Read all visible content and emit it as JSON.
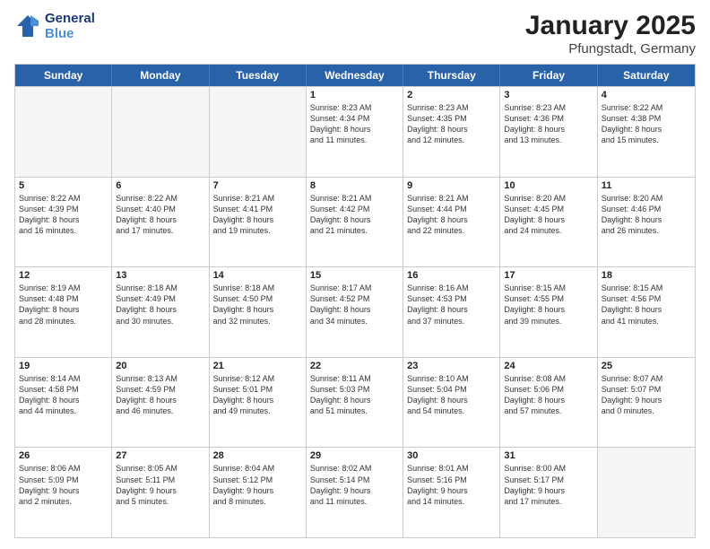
{
  "logo": {
    "line1": "General",
    "line2": "Blue"
  },
  "title": "January 2025",
  "location": "Pfungstadt, Germany",
  "header_days": [
    "Sunday",
    "Monday",
    "Tuesday",
    "Wednesday",
    "Thursday",
    "Friday",
    "Saturday"
  ],
  "weeks": [
    [
      {
        "day": "",
        "lines": []
      },
      {
        "day": "",
        "lines": []
      },
      {
        "day": "",
        "lines": []
      },
      {
        "day": "1",
        "lines": [
          "Sunrise: 8:23 AM",
          "Sunset: 4:34 PM",
          "Daylight: 8 hours",
          "and 11 minutes."
        ]
      },
      {
        "day": "2",
        "lines": [
          "Sunrise: 8:23 AM",
          "Sunset: 4:35 PM",
          "Daylight: 8 hours",
          "and 12 minutes."
        ]
      },
      {
        "day": "3",
        "lines": [
          "Sunrise: 8:23 AM",
          "Sunset: 4:36 PM",
          "Daylight: 8 hours",
          "and 13 minutes."
        ]
      },
      {
        "day": "4",
        "lines": [
          "Sunrise: 8:22 AM",
          "Sunset: 4:38 PM",
          "Daylight: 8 hours",
          "and 15 minutes."
        ]
      }
    ],
    [
      {
        "day": "5",
        "lines": [
          "Sunrise: 8:22 AM",
          "Sunset: 4:39 PM",
          "Daylight: 8 hours",
          "and 16 minutes."
        ]
      },
      {
        "day": "6",
        "lines": [
          "Sunrise: 8:22 AM",
          "Sunset: 4:40 PM",
          "Daylight: 8 hours",
          "and 17 minutes."
        ]
      },
      {
        "day": "7",
        "lines": [
          "Sunrise: 8:21 AM",
          "Sunset: 4:41 PM",
          "Daylight: 8 hours",
          "and 19 minutes."
        ]
      },
      {
        "day": "8",
        "lines": [
          "Sunrise: 8:21 AM",
          "Sunset: 4:42 PM",
          "Daylight: 8 hours",
          "and 21 minutes."
        ]
      },
      {
        "day": "9",
        "lines": [
          "Sunrise: 8:21 AM",
          "Sunset: 4:44 PM",
          "Daylight: 8 hours",
          "and 22 minutes."
        ]
      },
      {
        "day": "10",
        "lines": [
          "Sunrise: 8:20 AM",
          "Sunset: 4:45 PM",
          "Daylight: 8 hours",
          "and 24 minutes."
        ]
      },
      {
        "day": "11",
        "lines": [
          "Sunrise: 8:20 AM",
          "Sunset: 4:46 PM",
          "Daylight: 8 hours",
          "and 26 minutes."
        ]
      }
    ],
    [
      {
        "day": "12",
        "lines": [
          "Sunrise: 8:19 AM",
          "Sunset: 4:48 PM",
          "Daylight: 8 hours",
          "and 28 minutes."
        ]
      },
      {
        "day": "13",
        "lines": [
          "Sunrise: 8:18 AM",
          "Sunset: 4:49 PM",
          "Daylight: 8 hours",
          "and 30 minutes."
        ]
      },
      {
        "day": "14",
        "lines": [
          "Sunrise: 8:18 AM",
          "Sunset: 4:50 PM",
          "Daylight: 8 hours",
          "and 32 minutes."
        ]
      },
      {
        "day": "15",
        "lines": [
          "Sunrise: 8:17 AM",
          "Sunset: 4:52 PM",
          "Daylight: 8 hours",
          "and 34 minutes."
        ]
      },
      {
        "day": "16",
        "lines": [
          "Sunrise: 8:16 AM",
          "Sunset: 4:53 PM",
          "Daylight: 8 hours",
          "and 37 minutes."
        ]
      },
      {
        "day": "17",
        "lines": [
          "Sunrise: 8:15 AM",
          "Sunset: 4:55 PM",
          "Daylight: 8 hours",
          "and 39 minutes."
        ]
      },
      {
        "day": "18",
        "lines": [
          "Sunrise: 8:15 AM",
          "Sunset: 4:56 PM",
          "Daylight: 8 hours",
          "and 41 minutes."
        ]
      }
    ],
    [
      {
        "day": "19",
        "lines": [
          "Sunrise: 8:14 AM",
          "Sunset: 4:58 PM",
          "Daylight: 8 hours",
          "and 44 minutes."
        ]
      },
      {
        "day": "20",
        "lines": [
          "Sunrise: 8:13 AM",
          "Sunset: 4:59 PM",
          "Daylight: 8 hours",
          "and 46 minutes."
        ]
      },
      {
        "day": "21",
        "lines": [
          "Sunrise: 8:12 AM",
          "Sunset: 5:01 PM",
          "Daylight: 8 hours",
          "and 49 minutes."
        ]
      },
      {
        "day": "22",
        "lines": [
          "Sunrise: 8:11 AM",
          "Sunset: 5:03 PM",
          "Daylight: 8 hours",
          "and 51 minutes."
        ]
      },
      {
        "day": "23",
        "lines": [
          "Sunrise: 8:10 AM",
          "Sunset: 5:04 PM",
          "Daylight: 8 hours",
          "and 54 minutes."
        ]
      },
      {
        "day": "24",
        "lines": [
          "Sunrise: 8:08 AM",
          "Sunset: 5:06 PM",
          "Daylight: 8 hours",
          "and 57 minutes."
        ]
      },
      {
        "day": "25",
        "lines": [
          "Sunrise: 8:07 AM",
          "Sunset: 5:07 PM",
          "Daylight: 9 hours",
          "and 0 minutes."
        ]
      }
    ],
    [
      {
        "day": "26",
        "lines": [
          "Sunrise: 8:06 AM",
          "Sunset: 5:09 PM",
          "Daylight: 9 hours",
          "and 2 minutes."
        ]
      },
      {
        "day": "27",
        "lines": [
          "Sunrise: 8:05 AM",
          "Sunset: 5:11 PM",
          "Daylight: 9 hours",
          "and 5 minutes."
        ]
      },
      {
        "day": "28",
        "lines": [
          "Sunrise: 8:04 AM",
          "Sunset: 5:12 PM",
          "Daylight: 9 hours",
          "and 8 minutes."
        ]
      },
      {
        "day": "29",
        "lines": [
          "Sunrise: 8:02 AM",
          "Sunset: 5:14 PM",
          "Daylight: 9 hours",
          "and 11 minutes."
        ]
      },
      {
        "day": "30",
        "lines": [
          "Sunrise: 8:01 AM",
          "Sunset: 5:16 PM",
          "Daylight: 9 hours",
          "and 14 minutes."
        ]
      },
      {
        "day": "31",
        "lines": [
          "Sunrise: 8:00 AM",
          "Sunset: 5:17 PM",
          "Daylight: 9 hours",
          "and 17 minutes."
        ]
      },
      {
        "day": "",
        "lines": []
      }
    ]
  ]
}
